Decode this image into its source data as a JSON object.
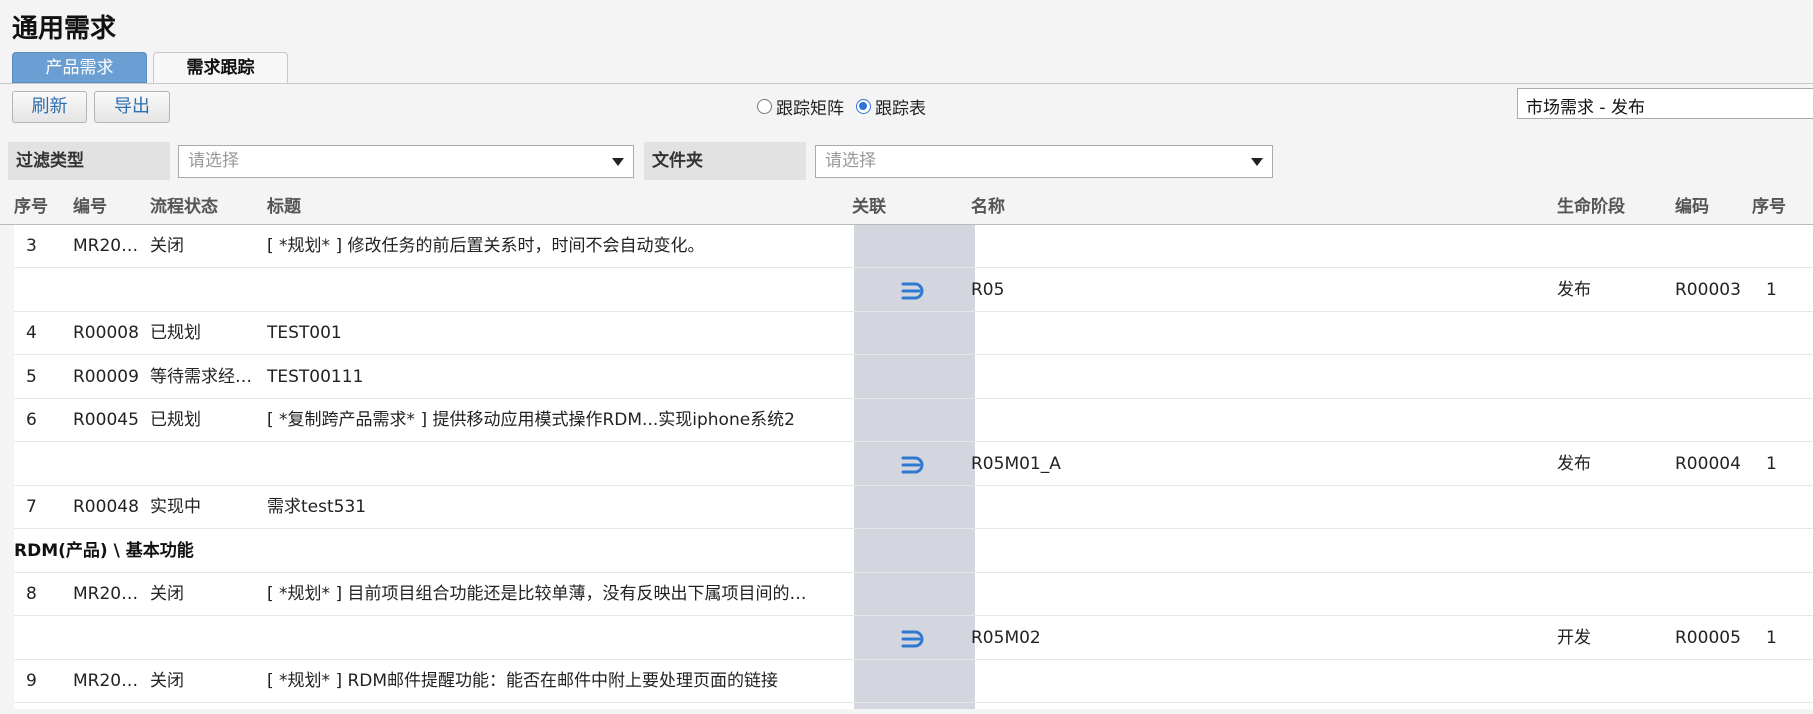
{
  "page": {
    "title": "通用需求"
  },
  "tabs": [
    {
      "label": "产品需求"
    },
    {
      "label": "需求跟踪"
    }
  ],
  "toolbar": {
    "refresh_label": "刷新",
    "export_label": "导出"
  },
  "view_mode": {
    "matrix_label": "跟踪矩阵",
    "table_label": "跟踪表",
    "selected": "跟踪表"
  },
  "phase_select": {
    "value": "市场需求 - 发布"
  },
  "filters": {
    "type_label": "过滤类型",
    "type_placeholder": "请选择",
    "folder_label": "文件夹",
    "folder_placeholder": "请选择"
  },
  "table": {
    "headers": {
      "seq": "序号",
      "code": "编号",
      "status": "流程状态",
      "title": "标题",
      "link": "关联",
      "name": "名称",
      "lifecycle": "生命阶段",
      "encoding": "编码",
      "seq2": "序号"
    },
    "rows": [
      {
        "kind": "req",
        "seq": "3",
        "code": "MR20…",
        "status": "关闭",
        "title": "[ *规划* ] 修改任务的前后置关系时，时间不会自动变化。"
      },
      {
        "kind": "link",
        "name": "R05",
        "lifecycle": "发布",
        "encoding": "R00003",
        "seq2": "1"
      },
      {
        "kind": "req",
        "seq": "4",
        "code": "R00008",
        "status": "已规划",
        "title": "TEST001"
      },
      {
        "kind": "req",
        "seq": "5",
        "code": "R00009",
        "status": "等待需求经…",
        "title": "TEST00111"
      },
      {
        "kind": "req",
        "seq": "6",
        "code": "R00045",
        "status": "已规划",
        "title": "[ *复制跨产品需求* ] 提供移动应用模式操作RDM...实现iphone系统2"
      },
      {
        "kind": "link",
        "name": "R05M01_A",
        "lifecycle": "发布",
        "encoding": "R00004",
        "seq2": "1"
      },
      {
        "kind": "req",
        "seq": "7",
        "code": "R00048",
        "status": "实现中",
        "title": "需求test531"
      },
      {
        "kind": "group",
        "label": "RDM(产品) \\ 基本功能"
      },
      {
        "kind": "req",
        "seq": "8",
        "code": "MR20…",
        "status": "关闭",
        "title": "[ *规划* ] 目前项目组合功能还是比较单薄，没有反映出下属项目间的…"
      },
      {
        "kind": "link",
        "name": "R05M02",
        "lifecycle": "开发",
        "encoding": "R00005",
        "seq2": "1"
      },
      {
        "kind": "req",
        "seq": "9",
        "code": "MR20…",
        "status": "关闭",
        "title": "[ *规划* ] RDM邮件提醒功能：能否在邮件中附上要处理页面的链接"
      }
    ]
  },
  "colors": {
    "tab_active": "#6b9ed2",
    "link_column": "#d3d5df",
    "link_icon": "#2f7ad0",
    "button_text": "#2f6fb0"
  },
  "icons": {
    "link": "trace-link-icon"
  }
}
